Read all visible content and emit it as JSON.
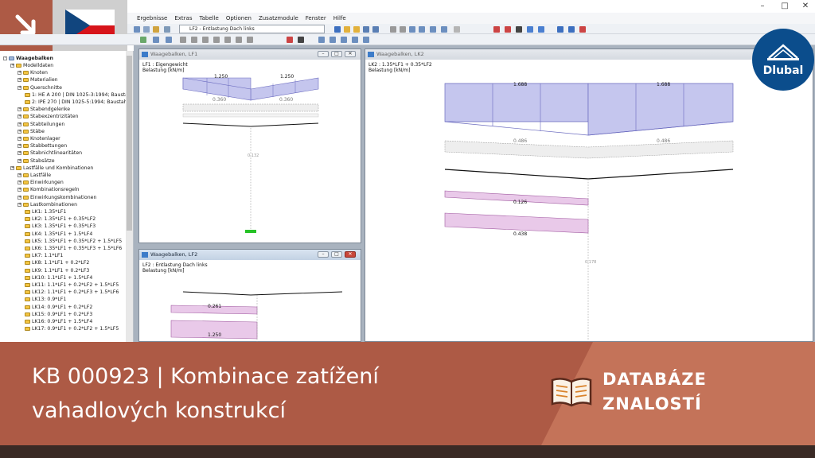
{
  "menu": [
    "Ergebnisse",
    "Extras",
    "Tabelle",
    "Optionen",
    "Zusatzmodule",
    "Fenster",
    "Hilfe"
  ],
  "toolbar": {
    "loadcase_combo": "LF2 - Entlastung Dach links"
  },
  "navigator": {
    "root": "Waagebalken",
    "items": [
      {
        "label": "Modelldaten",
        "level": 1
      },
      {
        "label": "Knoten",
        "level": 2
      },
      {
        "label": "Materialien",
        "level": 2
      },
      {
        "label": "Querschnitte",
        "level": 2
      },
      {
        "label": "1: HE A 200 | DIN 1025-3:1994; Bausta",
        "level": 3
      },
      {
        "label": "2: IPE 270 | DIN 1025-5:1994; Baustah",
        "level": 3
      },
      {
        "label": "Stabendgelenke",
        "level": 2
      },
      {
        "label": "Stabexzentrizitäten",
        "level": 2
      },
      {
        "label": "Stabteilungen",
        "level": 2
      },
      {
        "label": "Stäbe",
        "level": 2
      },
      {
        "label": "Knotenlager",
        "level": 2
      },
      {
        "label": "Stabbettungen",
        "level": 2
      },
      {
        "label": "Stabnichtlinearitäten",
        "level": 2
      },
      {
        "label": "Stabsätze",
        "level": 2
      },
      {
        "label": "Lastfälle und Kombinationen",
        "level": 1
      },
      {
        "label": "Lastfälle",
        "level": 2
      },
      {
        "label": "Einwirkungen",
        "level": 2
      },
      {
        "label": "Kombinationsregeln",
        "level": 2
      },
      {
        "label": "Einwirkungskombinationen",
        "level": 2
      },
      {
        "label": "Lastkombinationen",
        "level": 2
      },
      {
        "label": "LK1: 1.35*LF1",
        "level": 3
      },
      {
        "label": "LK2: 1.35*LF1 + 0.35*LF2",
        "level": 3
      },
      {
        "label": "LK3: 1.35*LF1 + 0.35*LF3",
        "level": 3
      },
      {
        "label": "LK4: 1.35*LF1 + 1.5*LF4",
        "level": 3
      },
      {
        "label": "LK5: 1.35*LF1 + 0.35*LF2 + 1.5*LF5",
        "level": 3
      },
      {
        "label": "LK6: 1.35*LF1 + 0.35*LF3 + 1.5*LF6",
        "level": 3
      },
      {
        "label": "LK7: 1.1*LF1",
        "level": 3
      },
      {
        "label": "LK8: 1.1*LF1 + 0.2*LF2",
        "level": 3
      },
      {
        "label": "LK9: 1.1*LF1 + 0.2*LF3",
        "level": 3
      },
      {
        "label": "LK10: 1.1*LF1 + 1.5*LF4",
        "level": 3
      },
      {
        "label": "LK11: 1.1*LF1 + 0.2*LF2 + 1.5*LF5",
        "level": 3
      },
      {
        "label": "LK12: 1.1*LF1 + 0.2*LF3 + 1.5*LF6",
        "level": 3
      },
      {
        "label": "LK13: 0.9*LF1",
        "level": 3
      },
      {
        "label": "LK14: 0.9*LF1 + 0.2*LF2",
        "level": 3
      },
      {
        "label": "LK15: 0.9*LF1 + 0.2*LF3",
        "level": 3
      },
      {
        "label": "LK16: 0.9*LF1 + 1.5*LF4",
        "level": 3
      },
      {
        "label": "LK17: 0.9*LF1 + 0.2*LF2 + 1.5*LF5",
        "level": 3
      }
    ]
  },
  "win1": {
    "title": "Waagebalken, LF1",
    "lc": "LF1 : Eigengewicht",
    "unit": "Belastung [kN/m]",
    "load_left": "1.250",
    "load_right": "1.250",
    "val_left": "0.360",
    "val_right": "0.360",
    "col_label": "0.132"
  },
  "win2": {
    "title": "Waagebalken, LF2",
    "lc": "LF2 : Entlastung Dach links",
    "unit": "Belastung [kN/m]",
    "val1": "0.261",
    "val2": "1.250"
  },
  "win3": {
    "title": "Waagebalken, LK2",
    "lc": "LK2 : 1.35*LF1 + 0.35*LF2",
    "unit": "Belastung [kN/m]",
    "load_left": "1.688",
    "load_right": "1.688",
    "val_left": "0.486",
    "val_right": "0.486",
    "val_mid1": "0.126",
    "val_mid2": "0.438",
    "col_label": "0.178"
  },
  "logo": {
    "text": "Dlubal"
  },
  "banner": {
    "title_line1": "KB 000923 | Kombinace zatížení",
    "title_line2": "vahadlových konstrukcí",
    "label_line1": "DATABÁZE",
    "label_line2": "ZNALOSTÍ"
  },
  "colors": {
    "banner": "#ad5a45",
    "banner_light": "#c47359",
    "load_blue": "#c5c6ee",
    "load_pink": "#e9c9e9",
    "logo": "#0b4d8c"
  }
}
